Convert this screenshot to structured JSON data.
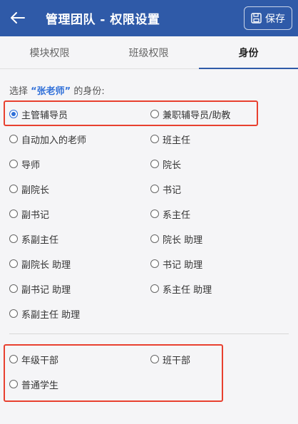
{
  "header": {
    "title": "管理团队 - 权限设置",
    "save_label": "保存",
    "bg_color": "#2f5aa8"
  },
  "tabs": [
    {
      "label": "模块权限",
      "active": false
    },
    {
      "label": "班级权限",
      "active": false
    },
    {
      "label": "身份",
      "active": true
    }
  ],
  "prompt": {
    "prefix": "选择 ",
    "name": "“张老师”",
    "suffix": " 的身份:"
  },
  "roles": [
    {
      "label": "主管辅导员",
      "checked": true
    },
    {
      "label": "兼职辅导员/助教",
      "checked": false
    },
    {
      "label": "自动加入的老师",
      "checked": false
    },
    {
      "label": "班主任",
      "checked": false
    },
    {
      "label": "导师",
      "checked": false
    },
    {
      "label": "院长",
      "checked": false
    },
    {
      "label": "副院长",
      "checked": false
    },
    {
      "label": "书记",
      "checked": false
    },
    {
      "label": "副书记",
      "checked": false
    },
    {
      "label": "系主任",
      "checked": false
    },
    {
      "label": "系副主任",
      "checked": false
    },
    {
      "label": "院长 助理",
      "checked": false
    },
    {
      "label": "副院长 助理",
      "checked": false
    },
    {
      "label": "书记 助理",
      "checked": false
    },
    {
      "label": "副书记 助理",
      "checked": false
    },
    {
      "label": "系主任 助理",
      "checked": false
    },
    {
      "label": "系副主任 助理",
      "checked": false
    }
  ],
  "student_roles": [
    {
      "label": "年级干部",
      "checked": false
    },
    {
      "label": "班干部",
      "checked": false
    },
    {
      "label": "普通学生",
      "checked": false
    }
  ],
  "accent_color": "#2f6fd8",
  "highlight_color": "#e8402f"
}
